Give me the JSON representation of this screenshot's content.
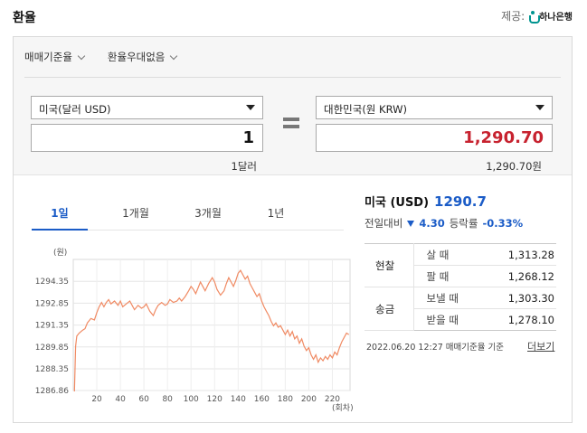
{
  "header": {
    "title": "환율",
    "provider_label": "제공:",
    "provider_name": "하나은행"
  },
  "filters": {
    "standard_label": "매매기준율",
    "discount_label": "환율우대없음"
  },
  "converter": {
    "from_currency": "미국(달러 USD)",
    "from_amount": "1",
    "from_unit_text": "1달러",
    "to_currency": "대한민국(원 KRW)",
    "to_amount": "1,290.70",
    "to_unit_text": "1,290.70원"
  },
  "tabs": [
    {
      "label": "1일",
      "active": true
    },
    {
      "label": "1개월",
      "active": false
    },
    {
      "label": "3개월",
      "active": false
    },
    {
      "label": "1년",
      "active": false
    }
  ],
  "summary": {
    "country": "미국 (USD)",
    "rate": "1290.7",
    "change_label": "전일대비",
    "change_value": "4.30",
    "change_direction": "down",
    "pct_label": "등락률",
    "pct_value": "-0.33%"
  },
  "rates_table": {
    "cash_label": "현찰",
    "transfer_label": "송금",
    "rows": [
      {
        "label": "살 때",
        "value": "1,313.28"
      },
      {
        "label": "팔 때",
        "value": "1,268.12"
      },
      {
        "label": "보낼 때",
        "value": "1,303.30"
      },
      {
        "label": "받을 때",
        "value": "1,278.10"
      }
    ]
  },
  "footnote": "2022.06.20 12:27  매매기준율 기준",
  "more_label": "더보기",
  "colors": {
    "accent_blue": "#1b5cc7",
    "krw_red": "#c7222f",
    "line_color": "#f08a63"
  },
  "chart_data": {
    "type": "line",
    "ylabel": "(원)",
    "xlabel": "(회차)",
    "yticks": [
      "1294.35",
      "1292.85",
      "1291.35",
      "1289.85",
      "1288.35",
      "1286.86"
    ],
    "ylim": [
      1286.86,
      1295.85
    ],
    "xticks": [
      "20",
      "40",
      "60",
      "80",
      "100",
      "120",
      "140",
      "160",
      "180",
      "200",
      "220"
    ],
    "xlim": [
      0,
      235
    ],
    "grid": true,
    "series": [
      {
        "values": [
          [
            1,
            1286.8
          ],
          [
            2,
            1289.9
          ],
          [
            3,
            1290.6
          ],
          [
            5,
            1290.8
          ],
          [
            8,
            1291.0
          ],
          [
            10,
            1291.1
          ],
          [
            12,
            1291.5
          ],
          [
            15,
            1291.8
          ],
          [
            18,
            1291.7
          ],
          [
            20,
            1292.2
          ],
          [
            22,
            1292.6
          ],
          [
            24,
            1292.9
          ],
          [
            26,
            1292.6
          ],
          [
            28,
            1292.9
          ],
          [
            30,
            1293.1
          ],
          [
            32,
            1292.8
          ],
          [
            35,
            1293.0
          ],
          [
            38,
            1292.7
          ],
          [
            40,
            1293.0
          ],
          [
            42,
            1292.6
          ],
          [
            45,
            1292.8
          ],
          [
            48,
            1293.0
          ],
          [
            50,
            1292.7
          ],
          [
            52,
            1292.4
          ],
          [
            55,
            1292.7
          ],
          [
            58,
            1292.5
          ],
          [
            60,
            1292.6
          ],
          [
            62,
            1292.8
          ],
          [
            65,
            1292.3
          ],
          [
            68,
            1292.0
          ],
          [
            70,
            1292.4
          ],
          [
            72,
            1292.7
          ],
          [
            75,
            1292.9
          ],
          [
            78,
            1292.7
          ],
          [
            80,
            1292.8
          ],
          [
            82,
            1293.1
          ],
          [
            85,
            1292.9
          ],
          [
            88,
            1293.0
          ],
          [
            90,
            1293.2
          ],
          [
            92,
            1293.0
          ],
          [
            95,
            1293.3
          ],
          [
            98,
            1293.7
          ],
          [
            100,
            1294.0
          ],
          [
            102,
            1293.8
          ],
          [
            104,
            1293.5
          ],
          [
            106,
            1293.9
          ],
          [
            108,
            1294.3
          ],
          [
            110,
            1294.0
          ],
          [
            112,
            1293.7
          ],
          [
            115,
            1294.2
          ],
          [
            118,
            1294.6
          ],
          [
            120,
            1294.3
          ],
          [
            122,
            1293.8
          ],
          [
            125,
            1293.4
          ],
          [
            128,
            1293.7
          ],
          [
            130,
            1294.2
          ],
          [
            132,
            1294.6
          ],
          [
            134,
            1294.3
          ],
          [
            136,
            1294.0
          ],
          [
            138,
            1294.4
          ],
          [
            140,
            1294.9
          ],
          [
            142,
            1295.1
          ],
          [
            144,
            1294.8
          ],
          [
            146,
            1294.5
          ],
          [
            148,
            1294.7
          ],
          [
            150,
            1294.2
          ],
          [
            152,
            1293.9
          ],
          [
            154,
            1293.6
          ],
          [
            156,
            1293.3
          ],
          [
            158,
            1293.5
          ],
          [
            160,
            1293.0
          ],
          [
            162,
            1292.6
          ],
          [
            164,
            1292.3
          ],
          [
            166,
            1292.0
          ],
          [
            168,
            1291.6
          ],
          [
            170,
            1291.3
          ],
          [
            172,
            1291.5
          ],
          [
            174,
            1291.2
          ],
          [
            176,
            1291.3
          ],
          [
            178,
            1291.0
          ],
          [
            180,
            1290.7
          ],
          [
            182,
            1291.0
          ],
          [
            184,
            1290.6
          ],
          [
            186,
            1290.9
          ],
          [
            188,
            1290.4
          ],
          [
            190,
            1290.6
          ],
          [
            192,
            1290.1
          ],
          [
            194,
            1290.4
          ],
          [
            196,
            1289.9
          ],
          [
            198,
            1289.6
          ],
          [
            200,
            1289.8
          ],
          [
            202,
            1289.3
          ],
          [
            204,
            1289.0
          ],
          [
            206,
            1289.3
          ],
          [
            208,
            1288.8
          ],
          [
            210,
            1289.1
          ],
          [
            212,
            1288.9
          ],
          [
            214,
            1289.2
          ],
          [
            216,
            1289.0
          ],
          [
            218,
            1289.3
          ],
          [
            220,
            1289.1
          ],
          [
            222,
            1289.5
          ],
          [
            224,
            1289.3
          ],
          [
            226,
            1289.8
          ],
          [
            228,
            1290.2
          ],
          [
            230,
            1290.5
          ],
          [
            232,
            1290.8
          ],
          [
            234,
            1290.7
          ]
        ]
      }
    ]
  }
}
